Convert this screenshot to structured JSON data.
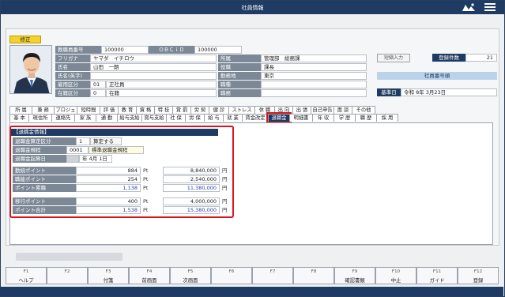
{
  "window": {
    "title": "社員情報"
  },
  "edit_badge": "修正",
  "header_fields": [
    {
      "label": "教職員番号",
      "value": "100000"
    },
    {
      "label": "フリガナ",
      "value": "ヤマダ　イチロウ"
    },
    {
      "label": "氏名",
      "value": "山田　一朗"
    },
    {
      "label": "氏名(英字)",
      "value": ""
    },
    {
      "label": "雇用区分",
      "code": "01",
      "value": "正社員"
    },
    {
      "label": "在籍区分",
      "code": "0",
      "value": "在籍"
    }
  ],
  "obcid": {
    "label": "ＯＢＣｉＤ",
    "value": "100000"
  },
  "org_fields": [
    {
      "label": "所属",
      "value": "管理部　総務課"
    },
    {
      "label": "役職",
      "value": "課長"
    },
    {
      "label": "勤務地",
      "value": "東京"
    },
    {
      "label": "職種",
      "value": ""
    },
    {
      "label": "職務",
      "value": ""
    }
  ],
  "short_entry_button": "短縮入力",
  "record_count": {
    "label": "登録件数",
    "value": "21"
  },
  "employee_order_label": "社員番号順",
  "base_date": {
    "label": "基準日",
    "value": "令和 8年 3月23日"
  },
  "tabs_row1": [
    "所 属",
    "兼 務",
    "プロジェ",
    "短時間",
    "評 価",
    "教 育",
    "資 格",
    "特 技",
    "賞 罰",
    "労 契",
    "健 診",
    "ストレス",
    "休 職",
    "出 向",
    "出 張",
    "自己申告",
    "面 談",
    "その他"
  ],
  "tabs_row2": [
    "基 本",
    "現住所",
    "連絡先",
    "家 族",
    "通 勤",
    "給与支給",
    "賞与支給",
    "社 保",
    "労 保",
    "給 与",
    "就 業",
    "賃金改定",
    "退職金",
    "明細書",
    "年 収",
    "学 歴",
    "職 歴",
    "採 用"
  ],
  "active_tab": "退職金",
  "section_title": "【退職金情報】",
  "retirement": {
    "calc_type": {
      "label": "退職金算定区分",
      "code": "1",
      "value": "算定する"
    },
    "rule": {
      "label": "退職金規程",
      "code": "0001",
      "value": "標準退職金規程"
    },
    "start_date": {
      "label": "退職金起算日",
      "value": "年  4月  1日"
    },
    "rows": [
      {
        "label": "勤続ポイント",
        "points": "884",
        "unit": "Pt",
        "amount": "8,840,000",
        "currency": "円",
        "blue": false
      },
      {
        "label": "職能ポイント",
        "points": "254",
        "unit": "Pt",
        "amount": "2,540,000",
        "currency": "円",
        "blue": false
      },
      {
        "label": "ポイント累積",
        "points": "1,138",
        "unit": "Pt",
        "amount": "11,380,000",
        "currency": "円",
        "blue": true
      },
      {
        "label": "移行ポイント",
        "points": "400",
        "unit": "Pt",
        "amount": "4,000,000",
        "currency": "円",
        "blue": false
      },
      {
        "label": "ポイント合計",
        "points": "1,538",
        "unit": "Pt",
        "amount": "15,380,000",
        "currency": "円",
        "blue": true
      }
    ]
  },
  "fkeys": [
    {
      "key": "F1",
      "label": "ヘルプ"
    },
    {
      "key": "F2",
      "label": ""
    },
    {
      "key": "F3",
      "label": "付箋"
    },
    {
      "key": "F4",
      "label": "前画面"
    },
    {
      "key": "F5",
      "label": "次画面"
    },
    {
      "key": "F6",
      "label": ""
    },
    {
      "key": "F7",
      "label": ""
    },
    {
      "key": "F8",
      "label": ""
    },
    {
      "key": "F9",
      "label": "確認書類"
    },
    {
      "key": "F10",
      "label": "中止"
    },
    {
      "key": "F11",
      "label": "ガイド"
    },
    {
      "key": "F12",
      "label": "登録"
    }
  ],
  "colors": {
    "accent": "#1e3b63",
    "highlight": "#d9141b",
    "label_bg": "#7c8896",
    "badge": "#f3d22a"
  }
}
